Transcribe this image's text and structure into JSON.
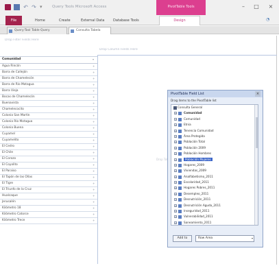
{
  "window": {
    "title": "Query Tools  Microsoft Access",
    "context_tab": "PivotTable Tools"
  },
  "ribbon": {
    "file": "File",
    "home": "Home",
    "create": "Create",
    "external_data": "External Data",
    "database_tools": "Database Tools",
    "design": "Design"
  },
  "doc_tabs": {
    "query": "Query-Tool Table Query",
    "design": "Consulta Tabela"
  },
  "pivot": {
    "filter_drop": "Drop Filter Fields Here",
    "column_drop": "Drop Column Fields Here",
    "data_drop": "Drop Totals or Detail Fields Here"
  },
  "rows": [
    "Comunidad",
    "Agua Rincón",
    "Barra de Callejón",
    "Barra de Chamelecón",
    "Barra de Río Motagua",
    "Barra Vieja",
    "Bocas de Chamelecón",
    "Buenavista",
    "Chamelecocito",
    "Colonia San Martín",
    "Colonia Río Motagua",
    "Colonia Buena",
    "Cuyamel",
    "Cuyamelito",
    "El Cedro",
    "El Chile",
    "El Corozo",
    "El Coyolito",
    "El Paraíso",
    "El Tapón de las Ollas",
    "El Tigre",
    "El Triunfo de la Cruz",
    "Hualcaque",
    "Jerusalén",
    "Kilómetro 18",
    "Kilómetro Catorce",
    "Kilómetro Trece"
  ],
  "field_list": {
    "title": "PivotTable Field List",
    "hint": "Drag items to the PivotTable list",
    "items": [
      "Consulta General",
      "Comunidad",
      "Comunidad",
      "Etnia",
      "Tenencia Comunidad",
      "Área Protegida",
      "Población Total",
      "Población 2009",
      "Población Hombres",
      "Población Mujeres",
      "Hogares_2009",
      "Viviendas_2009",
      "Analfabetismo_2011",
      "Escolaridad_2011",
      "Hogares Pobres_2011",
      "Desempleo_2011",
      "Desnutrición_2011",
      "Desnutrición Aguda_2011",
      "Inseguridad_2011",
      "Vulnerabilidad_2011",
      "Saneamiento_2011"
    ],
    "add_button": "Add to",
    "target": "Row Area"
  }
}
